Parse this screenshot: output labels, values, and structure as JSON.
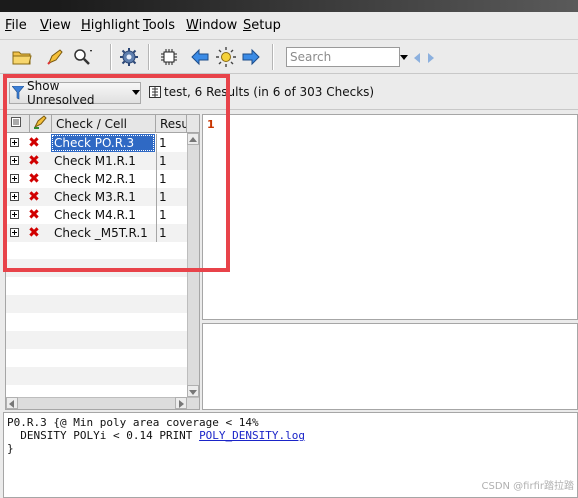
{
  "menubar": {
    "items": [
      {
        "label": "File"
      },
      {
        "label": "View"
      },
      {
        "label": "Highlight"
      },
      {
        "label": "Tools"
      },
      {
        "label": "Window"
      },
      {
        "label": "Setup"
      }
    ]
  },
  "toolbar": {
    "search_placeholder": "Search",
    "icons": [
      "open-folder-icon",
      "highlighter-icon",
      "zoom-icon",
      "gear-icon",
      "chip-icon",
      "back-arrow-icon",
      "sun-icon",
      "forward-arrow-icon"
    ]
  },
  "filter": {
    "show_label": "Show Unresolved",
    "summary": "test, 6 Results (in 6 of 303 Checks)"
  },
  "tree": {
    "col_check": "Check / Cell",
    "col_results": "Resu",
    "rows": [
      {
        "name": "Check PO.R.3",
        "count": "1",
        "selected": true
      },
      {
        "name": "Check M1.R.1",
        "count": "1"
      },
      {
        "name": "Check M2.R.1",
        "count": "1"
      },
      {
        "name": "Check M3.R.1",
        "count": "1"
      },
      {
        "name": "Check M4.R.1",
        "count": "1"
      },
      {
        "name": "Check _M5T.R.1",
        "count": "1"
      }
    ]
  },
  "result_index": "1",
  "code": {
    "line1": "P0.R.3 {@ Min poly area coverage < 14%",
    "line2_prefix": "  DENSITY POLYi < 0.14 PRINT ",
    "line2_link": "POLY_DENSITY.log",
    "line3": "}"
  },
  "watermark": "CSDN @firfir踏拉踏",
  "colors": {
    "selection": "#2f69c4",
    "error_x": "#d10000",
    "highlight_box": "#e8434a",
    "link": "#1a24c8"
  }
}
